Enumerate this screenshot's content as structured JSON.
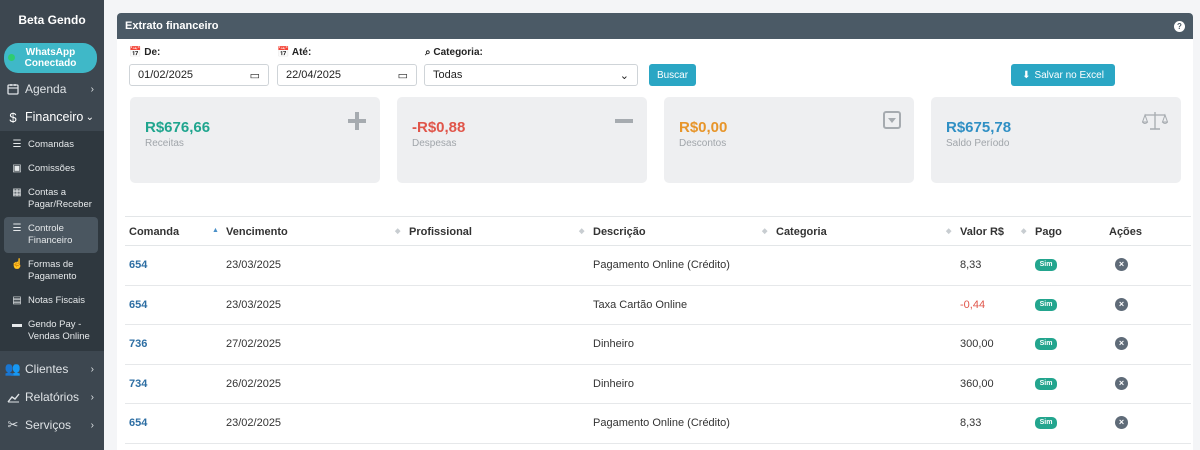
{
  "sidebar": {
    "brand": "Beta Gendo",
    "whatsapp": {
      "line1": "WhatsApp",
      "line2": "Conectado"
    },
    "agenda": {
      "label": "Agenda",
      "icon": "calendar-icon"
    },
    "financeiro": {
      "label": "Financeiro",
      "icon": "dollar-icon"
    },
    "sub": [
      {
        "label": "Comandas",
        "icon": "list-icon"
      },
      {
        "label": "Comissões",
        "icon": "money-icon"
      },
      {
        "label": "Contas a Pagar/Receber",
        "icon": "calculator-icon"
      },
      {
        "label": "Controle Financeiro",
        "icon": "list-check-icon"
      },
      {
        "label": "Formas de Pagamento",
        "icon": "thumbs-up-icon"
      },
      {
        "label": "Notas Fiscais",
        "icon": "document-icon"
      },
      {
        "label": "Gendo Pay - Vendas Online",
        "icon": "credit-card-icon"
      }
    ],
    "clientes": {
      "label": "Clientes",
      "icon": "users-icon"
    },
    "relatorios": {
      "label": "Relatórios",
      "icon": "chart-icon"
    },
    "servicos": {
      "label": "Serviços",
      "icon": "scissors-icon"
    }
  },
  "panel": {
    "title": "Extrato financeiro"
  },
  "filters": {
    "de_label": "De:",
    "de_value": "01/02/2025",
    "ate_label": "Até:",
    "ate_value": "22/04/2025",
    "categoria_label": "Categoria:",
    "categoria_value": "Todas",
    "buscar": "Buscar",
    "excel": "Salvar no Excel"
  },
  "cards": [
    {
      "value": "R$676,66",
      "label": "Receitas",
      "color": "#1fa58e",
      "icon": "plus-icon"
    },
    {
      "value": "-R$0,88",
      "label": "Despesas",
      "color": "#e0554a",
      "icon": "minus-icon"
    },
    {
      "value": "R$0,00",
      "label": "Descontos",
      "color": "#e7952a",
      "icon": "caret-down-box-icon"
    },
    {
      "value": "R$675,78",
      "label": "Saldo Período",
      "color": "#2f8fc4",
      "icon": "balance-scale-icon"
    }
  ],
  "table": {
    "headers": {
      "comanda": "Comanda",
      "vencimento": "Vencimento",
      "profissional": "Profissional",
      "descricao": "Descrição",
      "categoria": "Categoria",
      "valor": "Valor R$",
      "pago": "Pago",
      "acoes": "Ações"
    },
    "rows": [
      {
        "comanda": "654",
        "vencimento": "23/03/2025",
        "profissional": "",
        "descricao": "Pagamento Online (Crédito)",
        "categoria": "",
        "valor": "8,33",
        "pago": "Sim"
      },
      {
        "comanda": "654",
        "vencimento": "23/03/2025",
        "profissional": "",
        "descricao": "Taxa Cartão Online",
        "categoria": "",
        "valor": "-0,44",
        "pago": "Sim"
      },
      {
        "comanda": "736",
        "vencimento": "27/02/2025",
        "profissional": "",
        "descricao": "Dinheiro",
        "categoria": "",
        "valor": "300,00",
        "pago": "Sim"
      },
      {
        "comanda": "734",
        "vencimento": "26/02/2025",
        "profissional": "",
        "descricao": "Dinheiro",
        "categoria": "",
        "valor": "360,00",
        "pago": "Sim"
      },
      {
        "comanda": "654",
        "vencimento": "23/02/2025",
        "profissional": "",
        "descricao": "Pagamento Online (Crédito)",
        "categoria": "",
        "valor": "8,33",
        "pago": "Sim"
      }
    ]
  }
}
